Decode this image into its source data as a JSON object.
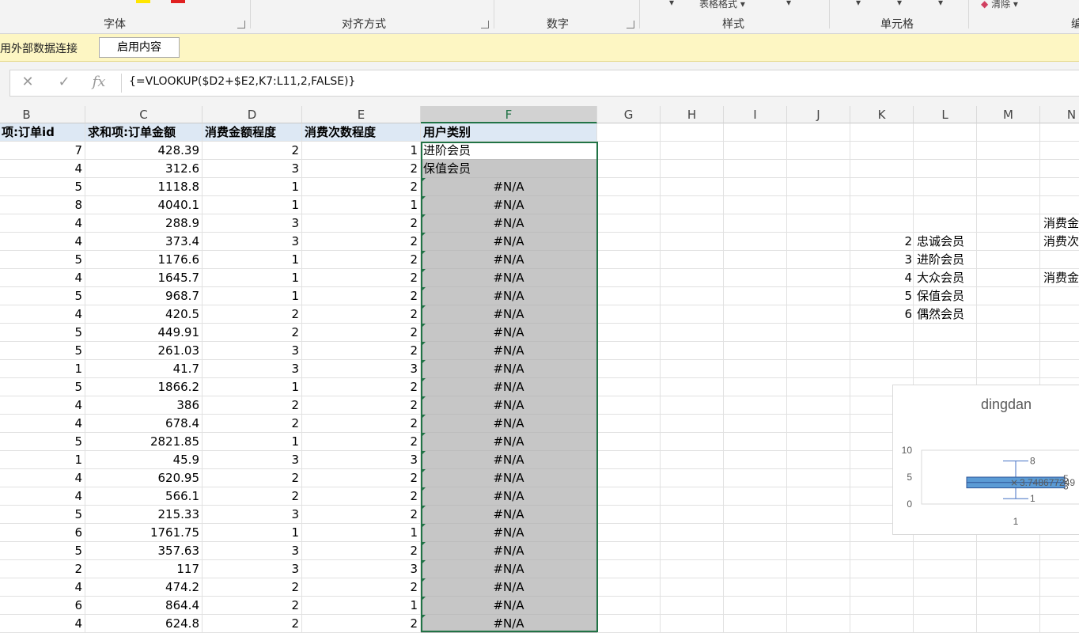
{
  "ribbon": {
    "groups": [
      "字体",
      "对齐方式",
      "数字",
      "样式",
      "单元格"
    ],
    "table_format_label": "表格格式",
    "clear_label": "清除",
    "edit_fragment": "编"
  },
  "message_bar": {
    "text": "用外部数据连接",
    "button_label": "启用内容"
  },
  "formula_bar": {
    "cancel_icon": "✕",
    "enter_icon": "✓",
    "fx_icon": "fx",
    "formula": "{=VLOOKUP($D2+$E2,K7:L11,2,FALSE)}"
  },
  "columns": [
    "B",
    "C",
    "D",
    "E",
    "F",
    "G",
    "H",
    "I",
    "J",
    "K",
    "L",
    "M",
    "N"
  ],
  "selected_column": "F",
  "table": {
    "headers": [
      "项:订单id",
      "求和项:订单金额",
      "消费金额程度",
      "消费次数程度",
      "用户类别"
    ],
    "rows": [
      [
        "7",
        "428.39",
        "2",
        "1",
        "进阶会员"
      ],
      [
        "4",
        "312.6",
        "3",
        "2",
        "保值会员"
      ],
      [
        "5",
        "1118.8",
        "1",
        "2",
        "#N/A"
      ],
      [
        "8",
        "4040.1",
        "1",
        "1",
        "#N/A"
      ],
      [
        "4",
        "288.9",
        "3",
        "2",
        "#N/A"
      ],
      [
        "4",
        "373.4",
        "3",
        "2",
        "#N/A"
      ],
      [
        "5",
        "1176.6",
        "1",
        "2",
        "#N/A"
      ],
      [
        "4",
        "1645.7",
        "1",
        "2",
        "#N/A"
      ],
      [
        "5",
        "968.7",
        "1",
        "2",
        "#N/A"
      ],
      [
        "4",
        "420.5",
        "2",
        "2",
        "#N/A"
      ],
      [
        "5",
        "449.91",
        "2",
        "2",
        "#N/A"
      ],
      [
        "5",
        "261.03",
        "3",
        "2",
        "#N/A"
      ],
      [
        "1",
        "41.7",
        "3",
        "3",
        "#N/A"
      ],
      [
        "5",
        "1866.2",
        "1",
        "2",
        "#N/A"
      ],
      [
        "4",
        "386",
        "2",
        "2",
        "#N/A"
      ],
      [
        "4",
        "678.4",
        "2",
        "2",
        "#N/A"
      ],
      [
        "5",
        "2821.85",
        "1",
        "2",
        "#N/A"
      ],
      [
        "1",
        "45.9",
        "3",
        "3",
        "#N/A"
      ],
      [
        "4",
        "620.95",
        "2",
        "2",
        "#N/A"
      ],
      [
        "4",
        "566.1",
        "2",
        "2",
        "#N/A"
      ],
      [
        "5",
        "215.33",
        "3",
        "2",
        "#N/A"
      ],
      [
        "6",
        "1761.75",
        "1",
        "1",
        "#N/A"
      ],
      [
        "5",
        "357.63",
        "3",
        "2",
        "#N/A"
      ],
      [
        "2",
        "117",
        "3",
        "3",
        "#N/A"
      ],
      [
        "4",
        "474.2",
        "2",
        "2",
        "#N/A"
      ],
      [
        "6",
        "864.4",
        "2",
        "1",
        "#N/A"
      ],
      [
        "4",
        "624.8",
        "2",
        "2",
        "#N/A"
      ]
    ]
  },
  "lookup": [
    {
      "k": "2",
      "l": "忠诚会员"
    },
    {
      "k": "3",
      "l": "进阶会员"
    },
    {
      "k": "4",
      "l": "大众会员"
    },
    {
      "k": "5",
      "l": "保值会员"
    },
    {
      "k": "6",
      "l": "偶然会员"
    }
  ],
  "n_column_fragments": [
    "消费金",
    "消费次",
    "消费金"
  ],
  "chart_data": {
    "type": "box",
    "title": "dingdan",
    "categories": [
      "1"
    ],
    "ylim": [
      0,
      10
    ],
    "yticks": [
      "0",
      "5",
      "10"
    ],
    "box": {
      "min": 1,
      "q1": 3,
      "median": 4,
      "q3": 5,
      "max": 8,
      "mean_label": "3.748677249"
    },
    "labels": [
      "8",
      "5",
      "3",
      "1"
    ],
    "color": "#5b9bd5"
  }
}
